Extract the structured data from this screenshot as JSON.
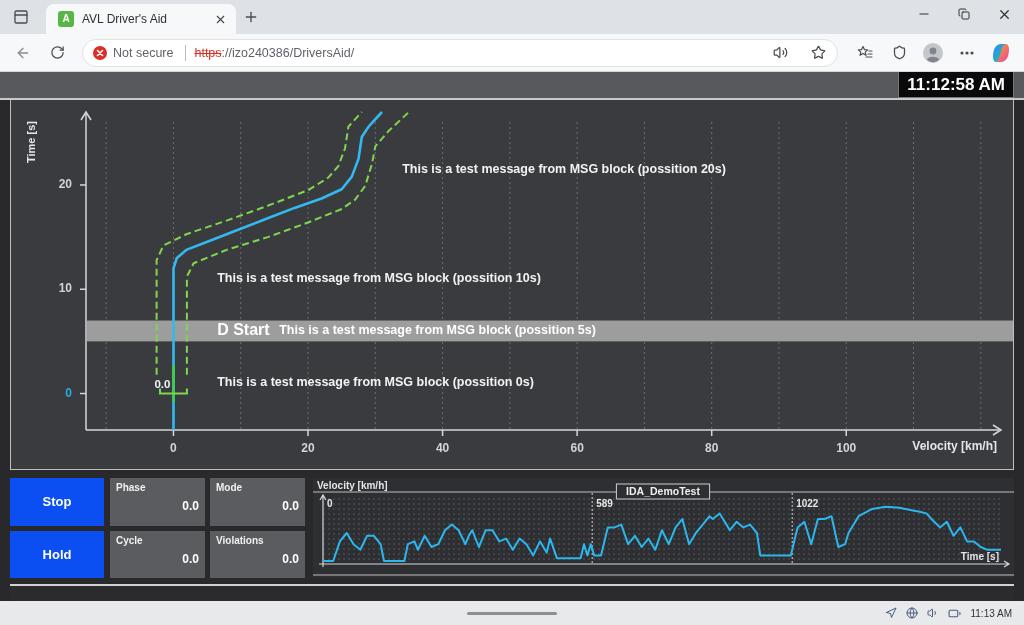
{
  "browser": {
    "tab": {
      "favicon": "A",
      "title": "AVL Driver's Aid",
      "selected": true
    },
    "address": {
      "secure": false,
      "security_label": "Not secure",
      "scheme": "https",
      "rest": "://izo240386/DriversAid/"
    }
  },
  "app": {
    "clock": "11:12:58 AM",
    "trajectory_chart": {
      "chart_data": {
        "type": "line",
        "xlabel": "Velocity [km/h]",
        "ylabel": "Time [s]",
        "xlim": [
          -13,
          123
        ],
        "ylim": [
          -3.5,
          27
        ],
        "xticks": [
          0,
          20,
          40,
          60,
          80,
          100
        ],
        "yticks": [
          0,
          10,
          20
        ],
        "grid": true,
        "series": [
          {
            "color": "#33b9f0",
            "x": [
              0,
              0,
              0.5,
              2,
              6,
              10,
              14,
              18,
              22,
              25,
              26.5,
              27.5,
              28,
              29,
              31
            ],
            "values": [
              -3.5,
              12,
              13,
              13.8,
              14.8,
              15.8,
              16.8,
              17.8,
              18.7,
              19.6,
              20.8,
              22.5,
              24.6,
              25.6,
              27
            ]
          },
          {
            "color": "#7fd64f",
            "line_style": "dashed",
            "x": [
              -2.5,
              -2.5,
              -1.5,
              2,
              8,
              14,
              20,
              23,
              24.5,
              25.5,
              26,
              28
            ],
            "values": [
              1.8,
              12.8,
              14.2,
              15.3,
              16.6,
              18,
              19.5,
              20.7,
              21.8,
              23.5,
              25.6,
              27
            ]
          },
          {
            "color": "#7fd64f",
            "line_style": "dashed",
            "x": [
              2,
              2,
              3,
              8,
              14,
              20,
              25,
              27,
              28.5,
              29.5,
              30,
              32,
              35
            ],
            "values": [
              1.8,
              11.2,
              12.5,
              13.8,
              15,
              16.4,
              17.7,
              18.6,
              19.9,
              22,
              23.7,
              25.2,
              27
            ]
          },
          {
            "color": "#3fcf4a",
            "x": [
              0,
              0
            ],
            "values": [
              2.7,
              -0.8
            ]
          }
        ],
        "bands": [
          {
            "axis": "y",
            "from": 5,
            "to": 7,
            "label": "D Start"
          }
        ],
        "annotations": [
          "This is a test message from MSG block (possition 20s)",
          "This is a test message from MSG block (possition 10s)",
          "This is a test message from MSG block (possition 5s)",
          "0.0",
          "This is a test message from MSG block (possition 0s)"
        ]
      }
    },
    "buttons": [
      {
        "label": "Stop"
      },
      {
        "label": "Hold"
      }
    ],
    "stats": [
      {
        "label": "Phase",
        "value": "0.0"
      },
      {
        "label": "Mode",
        "value": "0.0"
      },
      {
        "label": "Cycle",
        "value": "0.0"
      },
      {
        "label": "Violations",
        "value": "0.0"
      }
    ],
    "drive_profile": {
      "ylabel": "Velocity [km/h]",
      "title": "IDA_DemoTest",
      "markers": [
        "0",
        "589",
        "1022"
      ],
      "xlabel": "Time [s]"
    }
  },
  "taskbar": {
    "time": "11:13 AM"
  }
}
